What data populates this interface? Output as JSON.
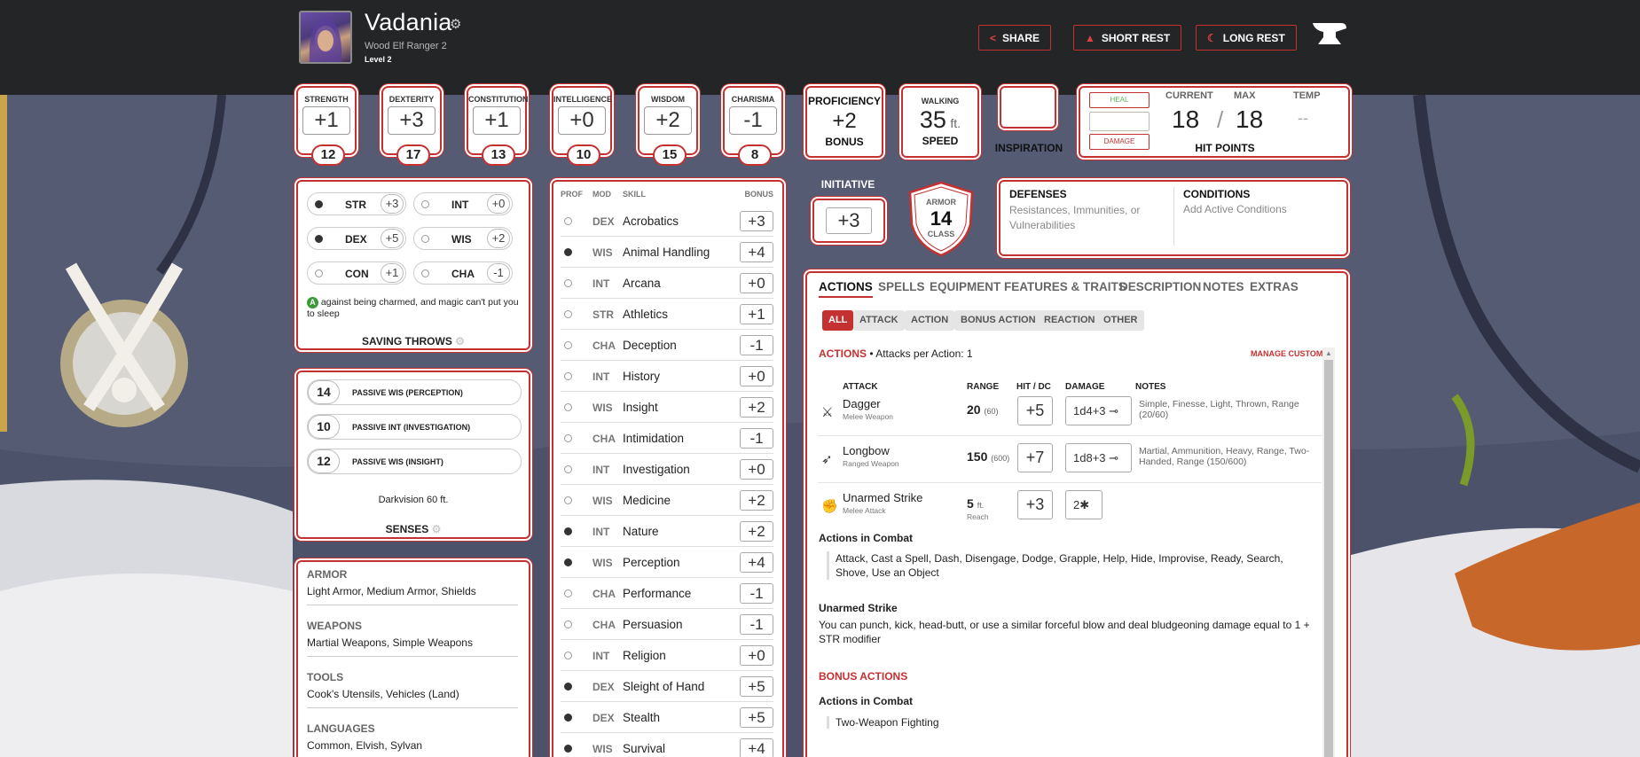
{
  "header": {
    "name": "Vadania",
    "subtitle": "Wood Elf  Ranger 2",
    "level": "Level 2",
    "buttons": {
      "share": "SHARE",
      "short_rest": "SHORT REST",
      "long_rest": "LONG REST"
    }
  },
  "abilities": [
    {
      "label": "STRENGTH",
      "mod": "+1",
      "score": "12"
    },
    {
      "label": "DEXTERITY",
      "mod": "+3",
      "score": "17"
    },
    {
      "label": "CONSTITUTION",
      "mod": "+1",
      "score": "13"
    },
    {
      "label": "INTELLIGENCE",
      "mod": "+0",
      "score": "10"
    },
    {
      "label": "WISDOM",
      "mod": "+2",
      "score": "15"
    },
    {
      "label": "CHARISMA",
      "mod": "-1",
      "score": "8"
    }
  ],
  "proficiency": {
    "title": "PROFICIENCY",
    "value": "+2",
    "sub": "BONUS"
  },
  "speed": {
    "title": "WALKING",
    "value": "35",
    "unit": "ft.",
    "sub": "SPEED"
  },
  "inspiration": {
    "label": "INSPIRATION"
  },
  "hit_points": {
    "heal": "HEAL",
    "damage": "DAMAGE",
    "current_label": "CURRENT",
    "max_label": "MAX",
    "temp_label": "TEMP",
    "current": "18",
    "max": "18",
    "temp": "--",
    "sep": "/",
    "title": "HIT POINTS"
  },
  "saving_throws": {
    "items": [
      {
        "abbr": "STR",
        "value": "+3",
        "prof": true
      },
      {
        "abbr": "INT",
        "value": "+0",
        "prof": false
      },
      {
        "abbr": "DEX",
        "value": "+5",
        "prof": true
      },
      {
        "abbr": "WIS",
        "value": "+2",
        "prof": false
      },
      {
        "abbr": "CON",
        "value": "+1",
        "prof": false
      },
      {
        "abbr": "CHA",
        "value": "-1",
        "prof": false
      }
    ],
    "note_badge": "A",
    "note": "against being charmed, and magic can't put you to sleep",
    "title": "SAVING THROWS"
  },
  "senses": {
    "items": [
      {
        "value": "14",
        "label": "PASSIVE WIS (PERCEPTION)"
      },
      {
        "value": "10",
        "label": "PASSIVE INT (INVESTIGATION)"
      },
      {
        "value": "12",
        "label": "PASSIVE WIS (INSIGHT)"
      }
    ],
    "darkvision": "Darkvision 60 ft.",
    "title": "SENSES"
  },
  "proficiencies": [
    {
      "heading": "ARMOR",
      "value": "Light Armor, Medium Armor, Shields"
    },
    {
      "heading": "WEAPONS",
      "value": "Martial Weapons, Simple Weapons"
    },
    {
      "heading": "TOOLS",
      "value": "Cook's Utensils, Vehicles (Land)"
    },
    {
      "heading": "LANGUAGES",
      "value": "Common, Elvish, Sylvan"
    }
  ],
  "skills": {
    "headers": {
      "prof": "PROF",
      "mod": "MOD",
      "skill": "SKILL",
      "bonus": "BONUS"
    },
    "items": [
      {
        "mod": "DEX",
        "name": "Acrobatics",
        "bonus": "+3",
        "prof": false
      },
      {
        "mod": "WIS",
        "name": "Animal Handling",
        "bonus": "+4",
        "prof": true
      },
      {
        "mod": "INT",
        "name": "Arcana",
        "bonus": "+0",
        "prof": false
      },
      {
        "mod": "STR",
        "name": "Athletics",
        "bonus": "+1",
        "prof": false
      },
      {
        "mod": "CHA",
        "name": "Deception",
        "bonus": "-1",
        "prof": false
      },
      {
        "mod": "INT",
        "name": "History",
        "bonus": "+0",
        "prof": false
      },
      {
        "mod": "WIS",
        "name": "Insight",
        "bonus": "+2",
        "prof": false
      },
      {
        "mod": "CHA",
        "name": "Intimidation",
        "bonus": "-1",
        "prof": false
      },
      {
        "mod": "INT",
        "name": "Investigation",
        "bonus": "+0",
        "prof": false
      },
      {
        "mod": "WIS",
        "name": "Medicine",
        "bonus": "+2",
        "prof": false
      },
      {
        "mod": "INT",
        "name": "Nature",
        "bonus": "+2",
        "prof": true
      },
      {
        "mod": "WIS",
        "name": "Perception",
        "bonus": "+4",
        "prof": true
      },
      {
        "mod": "CHA",
        "name": "Performance",
        "bonus": "-1",
        "prof": false
      },
      {
        "mod": "CHA",
        "name": "Persuasion",
        "bonus": "-1",
        "prof": false
      },
      {
        "mod": "INT",
        "name": "Religion",
        "bonus": "+0",
        "prof": false
      },
      {
        "mod": "DEX",
        "name": "Sleight of Hand",
        "bonus": "+5",
        "prof": true
      },
      {
        "mod": "DEX",
        "name": "Stealth",
        "bonus": "+5",
        "prof": true
      },
      {
        "mod": "WIS",
        "name": "Survival",
        "bonus": "+4",
        "prof": true
      }
    ]
  },
  "initiative": {
    "title": "INITIATIVE",
    "value": "+3"
  },
  "armor": {
    "top": "ARMOR",
    "value": "14",
    "bottom": "CLASS"
  },
  "defenses": {
    "title": "DEFENSES",
    "placeholder": "Resistances, Immunities, or Vulnerabilities"
  },
  "conditions": {
    "title": "CONDITIONS",
    "placeholder": "Add Active Conditions"
  },
  "tabs": [
    "ACTIONS",
    "SPELLS",
    "EQUIPMENT",
    "FEATURES & TRAITS",
    "DESCRIPTION",
    "NOTES",
    "EXTRAS"
  ],
  "filters": [
    "ALL",
    "ATTACK",
    "ACTION",
    "BONUS ACTION",
    "REACTION",
    "OTHER"
  ],
  "actions": {
    "section_title": "ACTIONS",
    "attacks_per_action": "• Attacks per Action: 1",
    "manage_custom": "MANAGE CUSTOM",
    "columns": {
      "attack": "ATTACK",
      "range": "RANGE",
      "hit": "HIT / DC",
      "damage": "DAMAGE",
      "notes": "NOTES"
    },
    "attacks": [
      {
        "name": "Dagger",
        "type": "Melee Weapon",
        "range": "20",
        "range_long": "(60)",
        "hit": "+5",
        "damage": "1d4+3",
        "notes": "Simple, Finesse, Light, Thrown, Range (20/60)"
      },
      {
        "name": "Longbow",
        "type": "Ranged Weapon",
        "range": "150",
        "range_long": "(600)",
        "hit": "+7",
        "damage": "1d8+3",
        "notes": "Martial, Ammunition, Heavy, Range, Two-Handed, Range (150/600)"
      },
      {
        "name": "Unarmed Strike",
        "type": "Melee Attack",
        "range": "5",
        "range_unit": "ft.",
        "range_sub": "Reach",
        "hit": "+3",
        "damage": "2",
        "notes": ""
      }
    ],
    "combat_title": "Actions in Combat",
    "combat_list": "Attack, Cast a Spell, Dash, Disengage, Dodge, Grapple, Help, Hide, Improvise, Ready, Search, Shove, Use an Object",
    "unarmed_title": "Unarmed Strike",
    "unarmed_text": "You can punch, kick, head-butt, or use a similar forceful blow and deal bludgeoning damage equal to 1 + STR modifier",
    "bonus_title": "BONUS ACTIONS",
    "bonus_combat_title": "Actions in Combat",
    "bonus_list": "Two-Weapon Fighting"
  },
  "colors": {
    "accent": "#c53131",
    "header_bg": "#242527",
    "heal": "#5cb85c"
  }
}
